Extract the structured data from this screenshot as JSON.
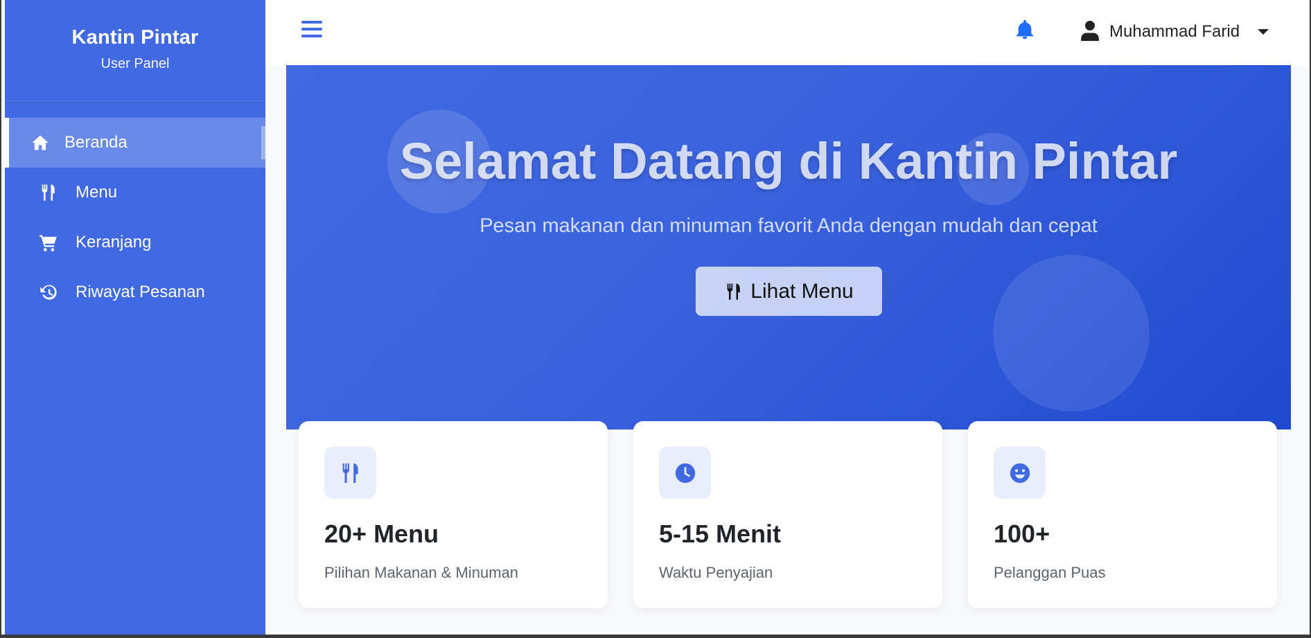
{
  "sidebar": {
    "brand_title": "Kantin Pintar",
    "brand_subtitle": "User Panel",
    "items": [
      {
        "label": "Beranda",
        "icon": "home-icon",
        "active": true
      },
      {
        "label": "Menu",
        "icon": "utensils-icon",
        "active": false
      },
      {
        "label": "Keranjang",
        "icon": "cart-icon",
        "active": false
      },
      {
        "label": "Riwayat Pesanan",
        "icon": "history-icon",
        "active": false
      }
    ]
  },
  "topbar": {
    "menu_toggle_icon": "hamburger-icon",
    "notification_icon": "bell-icon",
    "user_name": "Muhammad Farid"
  },
  "hero": {
    "title": "Selamat Datang di Kantin Pintar",
    "subtitle": "Pesan makanan dan minuman favorit Anda dengan mudah dan cepat",
    "button_label": "Lihat Menu",
    "button_icon": "utensils-icon"
  },
  "stats": [
    {
      "value": "20+ Menu",
      "label": "Pilihan Makanan & Minuman",
      "icon": "utensils-icon"
    },
    {
      "value": "5-15 Menit",
      "label": "Waktu Penyajian",
      "icon": "clock-icon"
    },
    {
      "value": "100+",
      "label": "Pelanggan Puas",
      "icon": "smile-icon"
    }
  ],
  "colors": {
    "primary": "#4169e1",
    "hero_end": "#2049d0",
    "card_icon_bg": "#e9eefc",
    "bell": "#1f6bff"
  }
}
